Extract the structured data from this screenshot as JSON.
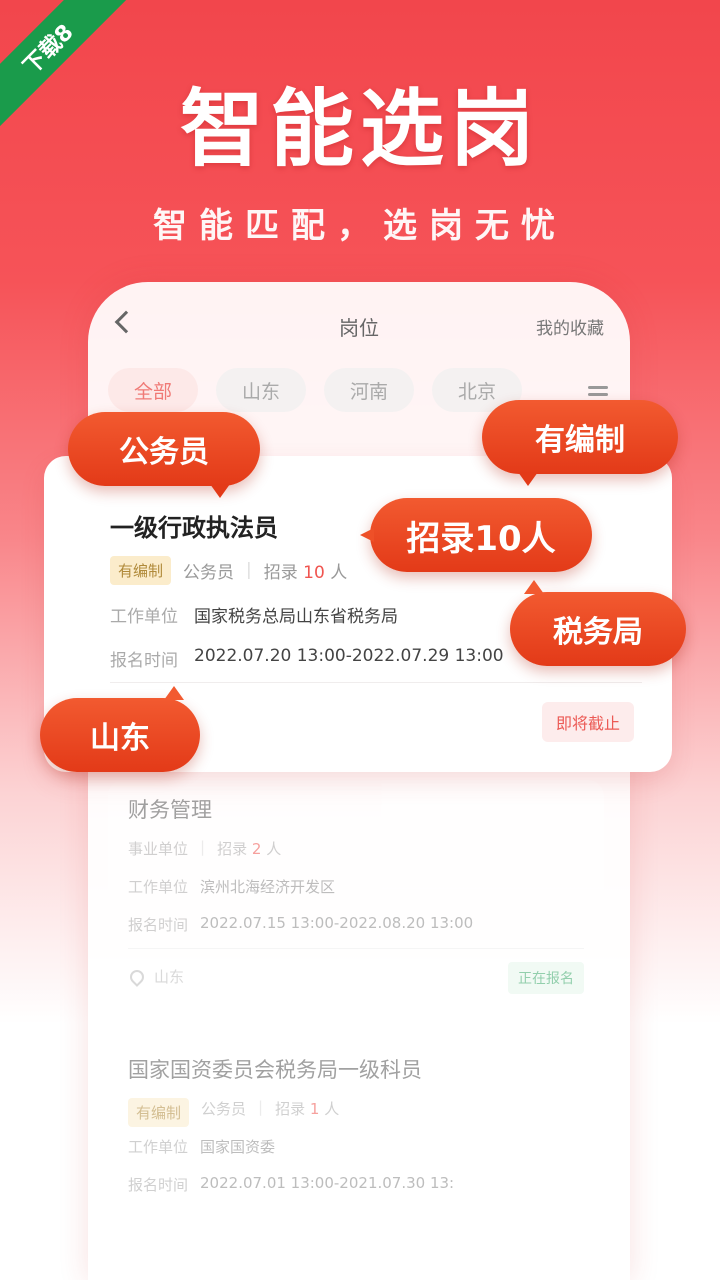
{
  "badge": "下载8",
  "headline": "智能选岗",
  "subline": "智能匹配，选岗无忧",
  "app": {
    "title": "岗位",
    "favorites": "我的收藏",
    "tabs": [
      "全部",
      "山东",
      "河南",
      "北京"
    ]
  },
  "main_card": {
    "title": "一级行政执法员",
    "tag": "有编制",
    "category": "公务员",
    "recruit_prefix": "招录",
    "recruit_num": "10",
    "recruit_unit": "人",
    "unit_label": "工作单位",
    "unit_value": "国家税务总局山东省税务局",
    "time_label": "报名时间",
    "time_value": "2022.07.20 13:00-2022.07.29 13:00",
    "status": "即将截止"
  },
  "card2": {
    "title": "财务管理",
    "category": "事业单位",
    "recruit_prefix": "招录",
    "recruit_num": "2",
    "recruit_unit": "人",
    "unit_label": "工作单位",
    "unit_value": "滨州北海经济开发区",
    "time_label": "报名时间",
    "time_value": "2022.07.15 13:00-2022.08.20 13:00",
    "location": "山东",
    "status": "正在报名"
  },
  "card3": {
    "title": "国家国资委员会税务局一级科员",
    "tag": "有编制",
    "category": "公务员",
    "recruit_prefix": "招录",
    "recruit_num": "1",
    "recruit_unit": "人",
    "unit_label": "工作单位",
    "unit_value": "国家国资委",
    "time_label": "报名时间",
    "time_value": "2022.07.01 13:00-2021.07.30 13:"
  },
  "bubbles": {
    "civil_servant": "公务员",
    "has_quota": "有编制",
    "recruit": "招录10人",
    "tax_bureau": "税务局",
    "shandong": "山东"
  },
  "colors": {
    "brand_red": "#f2464c",
    "bubble_orange": "#e33a18",
    "badge_green": "#1a9b4b"
  }
}
